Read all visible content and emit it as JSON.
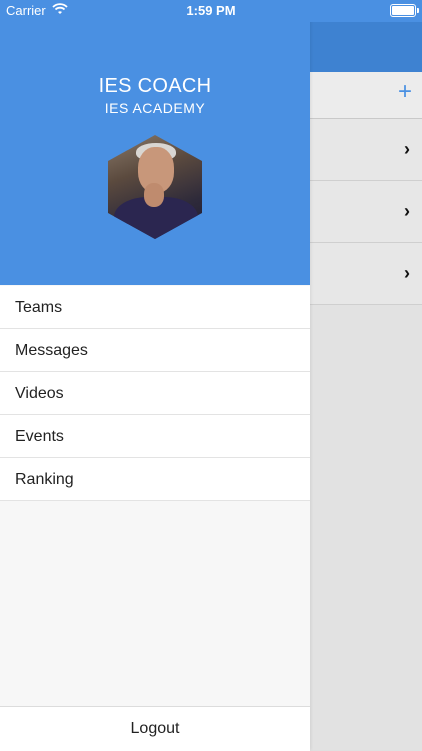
{
  "status_bar": {
    "carrier": "Carrier",
    "time": "1:59 PM"
  },
  "profile": {
    "name": "IES COACH",
    "organization": "IES ACADEMY"
  },
  "menu": {
    "items": [
      {
        "label": "Teams"
      },
      {
        "label": "Messages"
      },
      {
        "label": "Videos"
      },
      {
        "label": "Events"
      },
      {
        "label": "Ranking"
      }
    ],
    "logout_label": "Logout"
  },
  "background": {
    "add_label": "+",
    "chevron": "›"
  },
  "colors": {
    "header": "#4a90e2",
    "accent": "#4a90e2"
  }
}
